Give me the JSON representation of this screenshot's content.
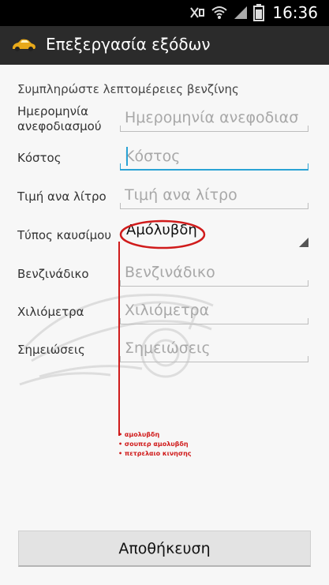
{
  "status_bar": {
    "time": "16:36"
  },
  "action_bar": {
    "title": "Επεξεργασία εξόδων"
  },
  "form": {
    "section_header": "Συμπληρώστε λεπτομέρειες βενζίνης",
    "date": {
      "label": "Ημερομηνία ανεφοδιασμού",
      "placeholder": "Ημερομηνία ανεφοδιασ"
    },
    "cost": {
      "label": "Κόστος",
      "placeholder": "Κόστος"
    },
    "price_per_liter": {
      "label": "Τιμή ανα λίτρο",
      "placeholder": "Τιμή ανα λίτρο"
    },
    "fuel_type": {
      "label": "Τύπος καυσίμου",
      "value": "Αμόλυβδη"
    },
    "gas_station": {
      "label": "Βενζινάδικο",
      "placeholder": "Βενζινάδικο"
    },
    "kilometers": {
      "label": "Χιλιόμετρα",
      "placeholder": "Χιλιόμετρα"
    },
    "notes": {
      "label": "Σημειώσεις",
      "placeholder": "Σημειώσεις"
    }
  },
  "annotation": {
    "color": "#d01b1b",
    "options": [
      "αμολυβδη",
      "σουπερ αμολυβδη",
      "πετρελαιο κινησης"
    ]
  },
  "save_button": {
    "label": "Αποθήκευση"
  },
  "colors": {
    "accent": "#2aa3d5",
    "action_bar": "#2b2b2b"
  }
}
